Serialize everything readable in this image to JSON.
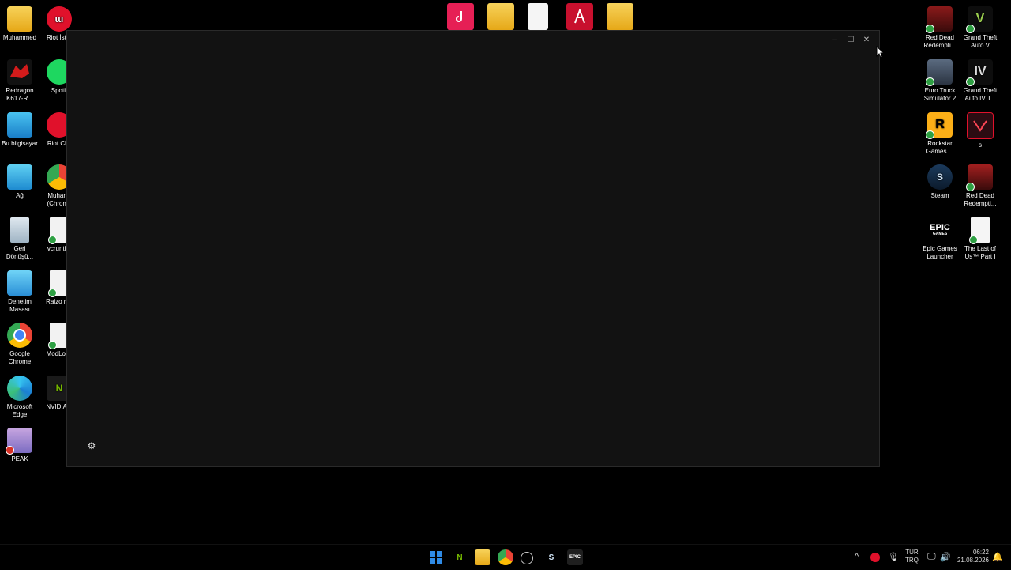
{
  "desktop": {
    "left_col1": [
      {
        "label": "Muhammed",
        "icon": "folder-icon"
      },
      {
        "label": "Redragon\nK617-R...",
        "icon": "redragon-icon"
      },
      {
        "label": "Bu bilgisayar",
        "icon": "computer-icon"
      },
      {
        "label": "Ağ",
        "icon": "network-icon"
      },
      {
        "label": "Geri\nDönüşü...",
        "icon": "recycle-bin-icon"
      },
      {
        "label": "Denetim\nMasası",
        "icon": "control-panel-icon"
      },
      {
        "label": "Google\nChrome",
        "icon": "chrome-icon"
      },
      {
        "label": "Microsoft\nEdge",
        "icon": "edge-icon"
      },
      {
        "label": "PEAK",
        "icon": "peak-icon"
      }
    ],
    "left_col2": [
      {
        "label": "Riot İster",
        "icon": "riot-icon"
      },
      {
        "label": "Spotif",
        "icon": "spotify-icon"
      },
      {
        "label": "Riot Clie",
        "icon": "riot-client-icon"
      },
      {
        "label": "Muhamr\n(Chrome",
        "icon": "chrome-profile-icon"
      },
      {
        "label": "vcruntim",
        "icon": "settings-file-icon"
      },
      {
        "label": "Raizo mo",
        "icon": "settings-file-icon"
      },
      {
        "label": "ModLoac",
        "icon": "settings-file-icon"
      },
      {
        "label": "NVIDIA A",
        "icon": "nvidia-icon"
      }
    ],
    "right_col1": [
      {
        "label": "Red Dead\nRedempti...",
        "icon": "rdr-icon"
      },
      {
        "label": "Euro Truck\nSimulator 2",
        "icon": "ets2-icon"
      },
      {
        "label": "Rockstar\nGames ...",
        "icon": "rockstar-icon"
      },
      {
        "label": "Steam",
        "icon": "steam-icon"
      },
      {
        "label": "Epic Games\nLauncher",
        "icon": "epic-icon"
      }
    ],
    "right_col2": [
      {
        "label": "Grand Theft\nAuto V",
        "icon": "gtav-icon"
      },
      {
        "label": "Grand Theft\nAuto IV T...",
        "icon": "gtaiv-icon"
      },
      {
        "label": "s",
        "icon": "valorant-icon"
      },
      {
        "label": "Red Dead\nRedempti...",
        "icon": "rdr2-icon"
      },
      {
        "label": "The Last of\nUs™ Part I",
        "icon": "blank-file-icon"
      }
    ],
    "epic_text": "EPIC",
    "epic_subtext": "GAMES",
    "rockstar_text": "R",
    "steam_text": "S",
    "gtav_text": "V",
    "gtaiv_text": "IV",
    "riot_text": "ɯ",
    "nvidia_text": "N"
  },
  "top_icons": [
    "tiktok-icon",
    "folder-icon",
    "file-icon",
    "app-a-icon",
    "folder-stack-icon"
  ],
  "window": {
    "minimize": "–",
    "maximize": "☐",
    "close": "✕",
    "settings": "⚙"
  },
  "taskbar": {
    "apps": [
      "start-icon",
      "nvidia-icon",
      "explorer-icon",
      "chrome-icon",
      "loader-icon",
      "steam-icon",
      "epic-icon"
    ],
    "lang_top": "TUR",
    "lang_bottom": "TRQ",
    "time": "06:22",
    "date": "21.08.2026",
    "tray_chevron": "^",
    "tray_mic": "🎙",
    "tray_volume": "🔊",
    "tray_monitor": "🖵",
    "tray_bell": "🔔"
  },
  "colors": {
    "window_bg": "#121212",
    "desktop_bg": "#000000",
    "accent_red": "#e0112b",
    "windows_blue": "#2f8be6"
  }
}
